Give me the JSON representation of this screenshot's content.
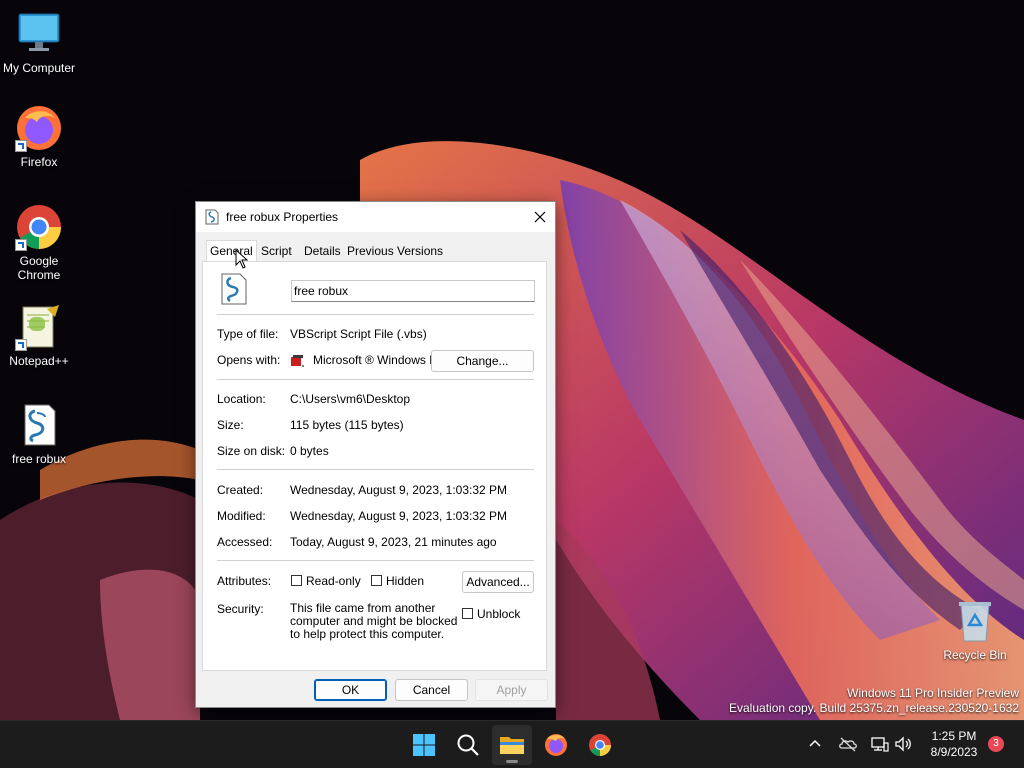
{
  "desktop": {
    "icons": [
      {
        "label": "My Computer"
      },
      {
        "label": "Firefox"
      },
      {
        "label": "Google Chrome"
      },
      {
        "label": "Notepad++"
      },
      {
        "label": "free robux"
      },
      {
        "label": "Recycle Bin"
      }
    ],
    "watermark": {
      "line1": "Windows 11 Pro Insider Preview",
      "line2": "Evaluation copy. Build 25375.zn_release.230520-1632"
    }
  },
  "dialog": {
    "title": "free robux Properties",
    "tabs": [
      {
        "label": "General",
        "active": true
      },
      {
        "label": "Script"
      },
      {
        "label": "Details"
      },
      {
        "label": "Previous Versions"
      }
    ],
    "general": {
      "file_name": "free robux",
      "type_label": "Type of file:",
      "type_value": "VBScript Script File (.vbs)",
      "opens_label": "Opens with:",
      "opens_value": "Microsoft ® Windows B",
      "change_label": "Change...",
      "location_label": "Location:",
      "location_value": "C:\\Users\\vm6\\Desktop",
      "size_label": "Size:",
      "size_value": "115 bytes (115 bytes)",
      "size_disk_label": "Size on disk:",
      "size_disk_value": "0 bytes",
      "created_label": "Created:",
      "created_value": "Wednesday, August 9, 2023, 1:03:32 PM",
      "modified_label": "Modified:",
      "modified_value": "Wednesday, August 9, 2023, 1:03:32 PM",
      "accessed_label": "Accessed:",
      "accessed_value": "Today, August 9, 2023, 21 minutes ago",
      "attributes_label": "Attributes:",
      "readonly_label": "Read-only",
      "hidden_label": "Hidden",
      "advanced_label": "Advanced...",
      "security_label": "Security:",
      "security_text": "This file came from another computer and might be blocked to help protect this computer.",
      "unblock_label": "Unblock"
    },
    "buttons": {
      "ok": "OK",
      "cancel": "Cancel",
      "apply": "Apply"
    }
  },
  "taskbar": {
    "time": "1:25 PM",
    "date": "8/9/2023",
    "notification_count": "3"
  },
  "colors": {
    "accent": "#005fb8",
    "taskbar": "#1c1c1c",
    "badge": "#e74856"
  }
}
